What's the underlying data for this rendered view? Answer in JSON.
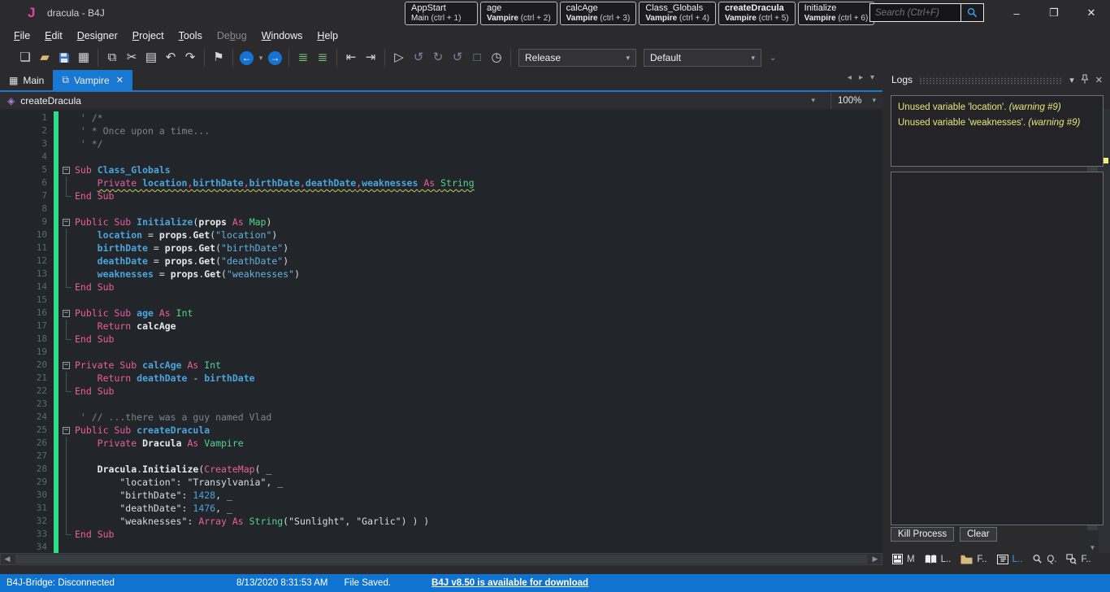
{
  "window": {
    "logo": "J",
    "title": "dracula - B4J",
    "controls": {
      "minimize": "–",
      "restore": "❐",
      "close": "✕"
    }
  },
  "search": {
    "placeholder": "Search (Ctrl+F)",
    "icon": "magnifier-icon"
  },
  "menu": {
    "items": [
      {
        "label": "File",
        "u": 0
      },
      {
        "label": "Edit",
        "u": 0
      },
      {
        "label": "Designer",
        "u": 0
      },
      {
        "label": "Project",
        "u": 0
      },
      {
        "label": "Tools",
        "u": 0
      },
      {
        "label": "Debug",
        "u": 2,
        "disabled": true
      },
      {
        "label": "Windows",
        "u": 0
      },
      {
        "label": "Help",
        "u": 0
      }
    ]
  },
  "bookmarks": [
    {
      "name": "AppStart",
      "name_bold": false,
      "module": "Main",
      "module_bold": false,
      "shortcut": "(ctrl + 1)"
    },
    {
      "name": "age",
      "name_bold": false,
      "module": "Vampire",
      "module_bold": true,
      "shortcut": "(ctrl + 2)"
    },
    {
      "name": "calcAge",
      "name_bold": false,
      "module": "Vampire",
      "module_bold": true,
      "shortcut": "(ctrl + 3)"
    },
    {
      "name": "Class_Globals",
      "name_bold": false,
      "module": "Vampire",
      "module_bold": true,
      "shortcut": "(ctrl + 4)"
    },
    {
      "name": "createDracula",
      "name_bold": true,
      "module": "Vampire",
      "module_bold": true,
      "shortcut": "(ctrl + 5)"
    },
    {
      "name": "Initialize",
      "name_bold": false,
      "module": "Vampire",
      "module_bold": true,
      "shortcut": "(ctrl + 6)"
    }
  ],
  "toolbar": {
    "release_value": "Release",
    "default_value": "Default",
    "groups": [
      {
        "icons": [
          {
            "n": "new-file-icon",
            "g": "❏"
          },
          {
            "n": "open-folder-icon",
            "g": "▰",
            "cls": "tan"
          },
          {
            "n": "save-icon",
            "g": "▪",
            "cls": "blue",
            "svg": "floppy"
          },
          {
            "n": "export-module-icon",
            "g": "▦"
          }
        ]
      },
      {
        "icons": [
          {
            "n": "copy-icon",
            "g": "⧉"
          },
          {
            "n": "cut-icon",
            "g": "✂"
          },
          {
            "n": "paste-icon",
            "g": "▤"
          },
          {
            "n": "undo-icon",
            "g": "↶"
          },
          {
            "n": "redo-icon",
            "g": "↷"
          }
        ]
      },
      {
        "icons": [
          {
            "n": "bookmark-icon",
            "g": "⚑"
          }
        ]
      },
      {
        "icons": [
          {
            "n": "navigate-back-icon",
            "g": "←",
            "cls": "circ"
          },
          {
            "n": "back-dropdown-icon",
            "g": "▾",
            "cls": "tiny"
          },
          {
            "n": "navigate-forward-icon",
            "g": "→",
            "cls": "circ"
          }
        ]
      },
      {
        "icons": [
          {
            "n": "comment-icon",
            "g": "≣",
            "cls": "grn"
          },
          {
            "n": "uncomment-icon",
            "g": "≣",
            "cls": "grn"
          }
        ]
      },
      {
        "icons": [
          {
            "n": "previous-sub-icon",
            "g": "⇤"
          },
          {
            "n": "next-sub-icon",
            "g": "⇥"
          }
        ]
      },
      {
        "icons": [
          {
            "n": "run-icon",
            "g": "▷"
          },
          {
            "n": "debug-resume-icon",
            "g": "↺",
            "cls": "dim"
          },
          {
            "n": "debug-restart-icon",
            "g": "↻",
            "cls": "dim"
          },
          {
            "n": "debug-step-icon",
            "g": "↺",
            "cls": "dim"
          },
          {
            "n": "stop-icon",
            "g": "□",
            "cls": "dim"
          },
          {
            "n": "profiler-icon",
            "g": "◷"
          }
        ]
      }
    ],
    "overflow_icon": "⌄"
  },
  "tabs": [
    {
      "label": "Main",
      "icon": "designer-grid-icon",
      "active": false
    },
    {
      "label": "Vampire",
      "icon": "class-icon",
      "active": true,
      "close": "✕"
    }
  ],
  "tab_controls": {
    "scroll_left": "◂",
    "scroll_right": "▸",
    "list_dropdown": "▾"
  },
  "breadcrumb": {
    "icon": "cube-icon",
    "sub": "createDracula",
    "caret": "▾",
    "zoom": "100%"
  },
  "editor": {
    "lines": [
      {
        "n": 1,
        "ind": 1,
        "g": "",
        "t": [
          [
            "c",
            "' /*"
          ]
        ]
      },
      {
        "n": 2,
        "ind": 1,
        "g": "",
        "t": [
          [
            "c",
            "' * Once upon a time..."
          ]
        ]
      },
      {
        "n": 3,
        "ind": 1,
        "g": "",
        "t": [
          [
            "c",
            "' */"
          ]
        ]
      },
      {
        "n": 4,
        "ind": 0,
        "g": "",
        "t": []
      },
      {
        "n": 5,
        "ind": 0,
        "g": "fold",
        "t": [
          [
            "k",
            "Sub "
          ],
          [
            "sn",
            "Class_Globals"
          ]
        ]
      },
      {
        "n": 6,
        "ind": 4,
        "g": "mid",
        "warn": true,
        "t": [
          [
            "k",
            "Private "
          ],
          [
            "v",
            "location"
          ],
          [
            "k",
            ","
          ],
          [
            "v",
            "birthDate"
          ],
          [
            "k",
            ","
          ],
          [
            "v",
            "birthDate"
          ],
          [
            "k",
            ","
          ],
          [
            "v",
            "deathDate"
          ],
          [
            "k",
            ","
          ],
          [
            "v",
            "weaknesses"
          ],
          [
            "k",
            " As "
          ],
          [
            "ty",
            "String"
          ]
        ]
      },
      {
        "n": 7,
        "ind": 0,
        "g": "end",
        "t": [
          [
            "k",
            "End Sub"
          ]
        ]
      },
      {
        "n": 8,
        "ind": 0,
        "g": "",
        "t": []
      },
      {
        "n": 9,
        "ind": 0,
        "g": "fold",
        "t": [
          [
            "k",
            "Public Sub "
          ],
          [
            "sn",
            "Initialize"
          ],
          [
            "pl",
            "("
          ],
          [
            "id",
            "props"
          ],
          [
            "k",
            " As "
          ],
          [
            "ty",
            "Map"
          ],
          [
            "pl",
            ")"
          ]
        ]
      },
      {
        "n": 10,
        "ind": 4,
        "g": "mid",
        "t": [
          [
            "v",
            "location"
          ],
          [
            "pl",
            " = "
          ],
          [
            "id",
            "props"
          ],
          [
            "pl",
            "."
          ],
          [
            "id",
            "Get"
          ],
          [
            "pl",
            "("
          ],
          [
            "st",
            "\"location\""
          ],
          [
            "pl",
            ")"
          ]
        ]
      },
      {
        "n": 11,
        "ind": 4,
        "g": "mid",
        "t": [
          [
            "v",
            "birthDate"
          ],
          [
            "pl",
            " = "
          ],
          [
            "id",
            "props"
          ],
          [
            "pl",
            "."
          ],
          [
            "id",
            "Get"
          ],
          [
            "pl",
            "("
          ],
          [
            "st",
            "\"birthDate\""
          ],
          [
            "pl",
            ")"
          ]
        ]
      },
      {
        "n": 12,
        "ind": 4,
        "g": "mid",
        "t": [
          [
            "v",
            "deathDate"
          ],
          [
            "pl",
            " = "
          ],
          [
            "id",
            "props"
          ],
          [
            "pl",
            "."
          ],
          [
            "id",
            "Get"
          ],
          [
            "pl",
            "("
          ],
          [
            "st",
            "\"deathDate\""
          ],
          [
            "pl",
            ")"
          ]
        ]
      },
      {
        "n": 13,
        "ind": 4,
        "g": "mid",
        "t": [
          [
            "v",
            "weaknesses"
          ],
          [
            "pl",
            " = "
          ],
          [
            "id",
            "props"
          ],
          [
            "pl",
            "."
          ],
          [
            "id",
            "Get"
          ],
          [
            "pl",
            "("
          ],
          [
            "st",
            "\"weaknesses\""
          ],
          [
            "pl",
            ")"
          ]
        ]
      },
      {
        "n": 14,
        "ind": 0,
        "g": "end",
        "t": [
          [
            "k",
            "End Sub"
          ]
        ]
      },
      {
        "n": 15,
        "ind": 0,
        "g": "",
        "t": []
      },
      {
        "n": 16,
        "ind": 0,
        "g": "fold",
        "t": [
          [
            "k",
            "Public Sub "
          ],
          [
            "sn",
            "age"
          ],
          [
            "k",
            " As "
          ],
          [
            "ty",
            "Int"
          ]
        ]
      },
      {
        "n": 17,
        "ind": 4,
        "g": "mid",
        "t": [
          [
            "k",
            "Return "
          ],
          [
            "id",
            "calcAge"
          ]
        ]
      },
      {
        "n": 18,
        "ind": 0,
        "g": "end",
        "t": [
          [
            "k",
            "End Sub"
          ]
        ]
      },
      {
        "n": 19,
        "ind": 0,
        "g": "",
        "t": []
      },
      {
        "n": 20,
        "ind": 0,
        "g": "fold",
        "t": [
          [
            "k",
            "Private Sub "
          ],
          [
            "sn",
            "calcAge"
          ],
          [
            "k",
            " As "
          ],
          [
            "ty",
            "Int"
          ]
        ]
      },
      {
        "n": 21,
        "ind": 4,
        "g": "mid",
        "t": [
          [
            "k",
            "Return "
          ],
          [
            "v",
            "deathDate"
          ],
          [
            "pl",
            " - "
          ],
          [
            "v",
            "birthDate"
          ]
        ]
      },
      {
        "n": 22,
        "ind": 0,
        "g": "end",
        "t": [
          [
            "k",
            "End Sub"
          ]
        ]
      },
      {
        "n": 23,
        "ind": 0,
        "g": "",
        "t": []
      },
      {
        "n": 24,
        "ind": 1,
        "g": "",
        "t": [
          [
            "c",
            "' // ...there was a guy named Vlad"
          ]
        ]
      },
      {
        "n": 25,
        "ind": 0,
        "g": "fold",
        "t": [
          [
            "k",
            "Public Sub "
          ],
          [
            "sn",
            "createDracula"
          ]
        ]
      },
      {
        "n": 26,
        "ind": 4,
        "g": "mid",
        "t": [
          [
            "k",
            "Private "
          ],
          [
            "id",
            "Dracula"
          ],
          [
            "k",
            " As "
          ],
          [
            "ty",
            "Vampire"
          ]
        ]
      },
      {
        "n": 27,
        "ind": 0,
        "g": "mid",
        "t": []
      },
      {
        "n": 28,
        "ind": 4,
        "g": "mid",
        "t": [
          [
            "id",
            "Dracula"
          ],
          [
            "pl",
            "."
          ],
          [
            "id",
            "Initialize"
          ],
          [
            "pl",
            "("
          ],
          [
            "k",
            "CreateMap"
          ],
          [
            "pl",
            "( _"
          ]
        ]
      },
      {
        "n": 29,
        "ind": 8,
        "g": "mid",
        "t": [
          [
            "sw",
            "\"location\""
          ],
          [
            "pl",
            ": "
          ],
          [
            "sw",
            "\"Transylvania\""
          ],
          [
            "pl",
            ", _"
          ]
        ]
      },
      {
        "n": 30,
        "ind": 8,
        "g": "mid",
        "t": [
          [
            "sw",
            "\"birthDate\""
          ],
          [
            "pl",
            ": "
          ],
          [
            "nu",
            "1428"
          ],
          [
            "pl",
            ", _"
          ]
        ]
      },
      {
        "n": 31,
        "ind": 8,
        "g": "mid",
        "t": [
          [
            "sw",
            "\"deathDate\""
          ],
          [
            "pl",
            ": "
          ],
          [
            "nu",
            "1476"
          ],
          [
            "pl",
            ", _"
          ]
        ]
      },
      {
        "n": 32,
        "ind": 8,
        "g": "mid",
        "t": [
          [
            "sw",
            "\"weaknesses\""
          ],
          [
            "pl",
            ": "
          ],
          [
            "k",
            "Array As "
          ],
          [
            "ty",
            "String"
          ],
          [
            "pl",
            "("
          ],
          [
            "sw",
            "\"Sunlight\""
          ],
          [
            "pl",
            ", "
          ],
          [
            "sw",
            "\"Garlic\""
          ],
          [
            "pl",
            ") ) )"
          ]
        ]
      },
      {
        "n": 33,
        "ind": 0,
        "g": "end",
        "t": [
          [
            "k",
            "End Sub"
          ]
        ]
      },
      {
        "n": 34,
        "ind": 0,
        "g": "",
        "t": []
      }
    ]
  },
  "logs": {
    "title": "Logs",
    "header_icons": {
      "dropdown": "▾",
      "pin": "pin-icon",
      "close": "✕"
    },
    "entries": [
      {
        "text": "Unused variable 'location'. ",
        "note": "(warning #9)"
      },
      {
        "text": "Unused variable 'weaknesses'. ",
        "note": "(warning #9)"
      }
    ],
    "kill_label": "Kill Process",
    "clear_label": "Clear"
  },
  "tool_tabs": [
    {
      "icon": "modules-grid-icon",
      "label": "M",
      "active": false
    },
    {
      "icon": "libraries-book-icon",
      "label": "L..",
      "active": false
    },
    {
      "icon": "files-folder-icon",
      "label": "F..",
      "active": false
    },
    {
      "icon": "logs-list-icon",
      "label": "L..",
      "active": true
    },
    {
      "icon": "quick-search-icon",
      "label": "Q.",
      "active": false
    },
    {
      "icon": "find-references-icon",
      "label": "F..",
      "active": false
    }
  ],
  "statusbar": {
    "bridge": "B4J-Bridge: Disconnected",
    "time": "8/13/2020 8:31:53 AM",
    "saved": "File Saved.",
    "link": "B4J v8.50 is available for download"
  },
  "colors": {
    "accent_blue": "#1878d2",
    "status_blue": "#1173d0",
    "warning_yellow": "#e8e87d",
    "change_bar_green": "#2ddd86",
    "keyword_pink": "#ef5ba1",
    "type_green": "#4fd68f",
    "identifier_blue": "#4aa4dd",
    "logo_pink": "#e044a7"
  }
}
